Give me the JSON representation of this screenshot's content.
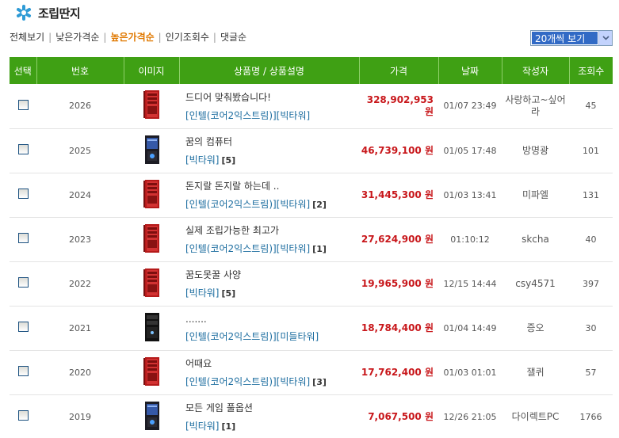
{
  "header": {
    "title": "조립딴지",
    "icon": "asterisk-icon"
  },
  "sort": {
    "items": [
      {
        "label": "전체보기",
        "active": false
      },
      {
        "label": "낮은가격순",
        "active": false
      },
      {
        "label": "높은가격순",
        "active": true
      },
      {
        "label": "인기조회수",
        "active": false
      },
      {
        "label": "댓글순",
        "active": false
      }
    ],
    "separator": "|"
  },
  "perpage": {
    "value": "20개씩 보기"
  },
  "table": {
    "columns": [
      "선택",
      "번호",
      "이미지",
      "상품명 / 상품설명",
      "가격",
      "날짜",
      "작성자",
      "조회수"
    ],
    "rows": [
      {
        "no": "2026",
        "image": "red-tower-case",
        "title": "드디어 맞춰봤습니다!",
        "category": "[인텔(코어2익스트림)][빅타워]",
        "comments": "",
        "price": "328,902,953 원",
        "date": "01/07 23:49",
        "author": "사랑하고~싶어라",
        "views": "45"
      },
      {
        "no": "2025",
        "image": "black-blue-tower-case",
        "title": "꿈의 컴퓨터",
        "category": "[빅타워]",
        "comments": "[5]",
        "price": "46,739,100 원",
        "date": "01/05 17:48",
        "author": "방명광",
        "views": "101"
      },
      {
        "no": "2024",
        "image": "red-tower-case",
        "title": "돈지랄 돈지랄 하는데 ..",
        "category": "[인텔(코어2익스트림)][빅타워]",
        "comments": "[2]",
        "price": "31,445,300 원",
        "date": "01/03 13:41",
        "author": "미파엘",
        "views": "131"
      },
      {
        "no": "2023",
        "image": "red-tower-case",
        "title": "실제 조립가능한 최고가",
        "category": "[인텔(코어2익스트림)][빅타워]",
        "comments": "[1]",
        "price": "27,624,900 원",
        "date": "01:10:12",
        "author": "skcha",
        "views": "40"
      },
      {
        "no": "2022",
        "image": "red-tower-case",
        "title": "꿈도못꿀 사양",
        "category": "[빅타워]",
        "comments": "[5]",
        "price": "19,965,900 원",
        "date": "12/15 14:44",
        "author": "csy4571",
        "views": "397"
      },
      {
        "no": "2021",
        "image": "black-tower-case",
        "title": ".......",
        "category": "[인텔(코어2익스트림)][미들타워]",
        "comments": "",
        "price": "18,784,400 원",
        "date": "01/04 14:49",
        "author": "증오",
        "views": "30"
      },
      {
        "no": "2020",
        "image": "red-tower-case",
        "title": "어때요",
        "category": "[인텔(코어2익스트림)][빅타워]",
        "comments": "[3]",
        "price": "17,762,400 원",
        "date": "01/03 01:01",
        "author": "잴퀴",
        "views": "57"
      },
      {
        "no": "2019",
        "image": "black-blue-tower-case",
        "title": "모든 게임 풀옵션",
        "category": "[빅타워]",
        "comments": "[1]",
        "price": "7,067,500 원",
        "date": "12/26 21:05",
        "author": "다이렉트PC",
        "views": "1766"
      }
    ]
  },
  "colors": {
    "header_green": "#3fa014",
    "price_red": "#c8171b",
    "category_blue": "#1b6c9f",
    "active_sort": "#e07800"
  }
}
